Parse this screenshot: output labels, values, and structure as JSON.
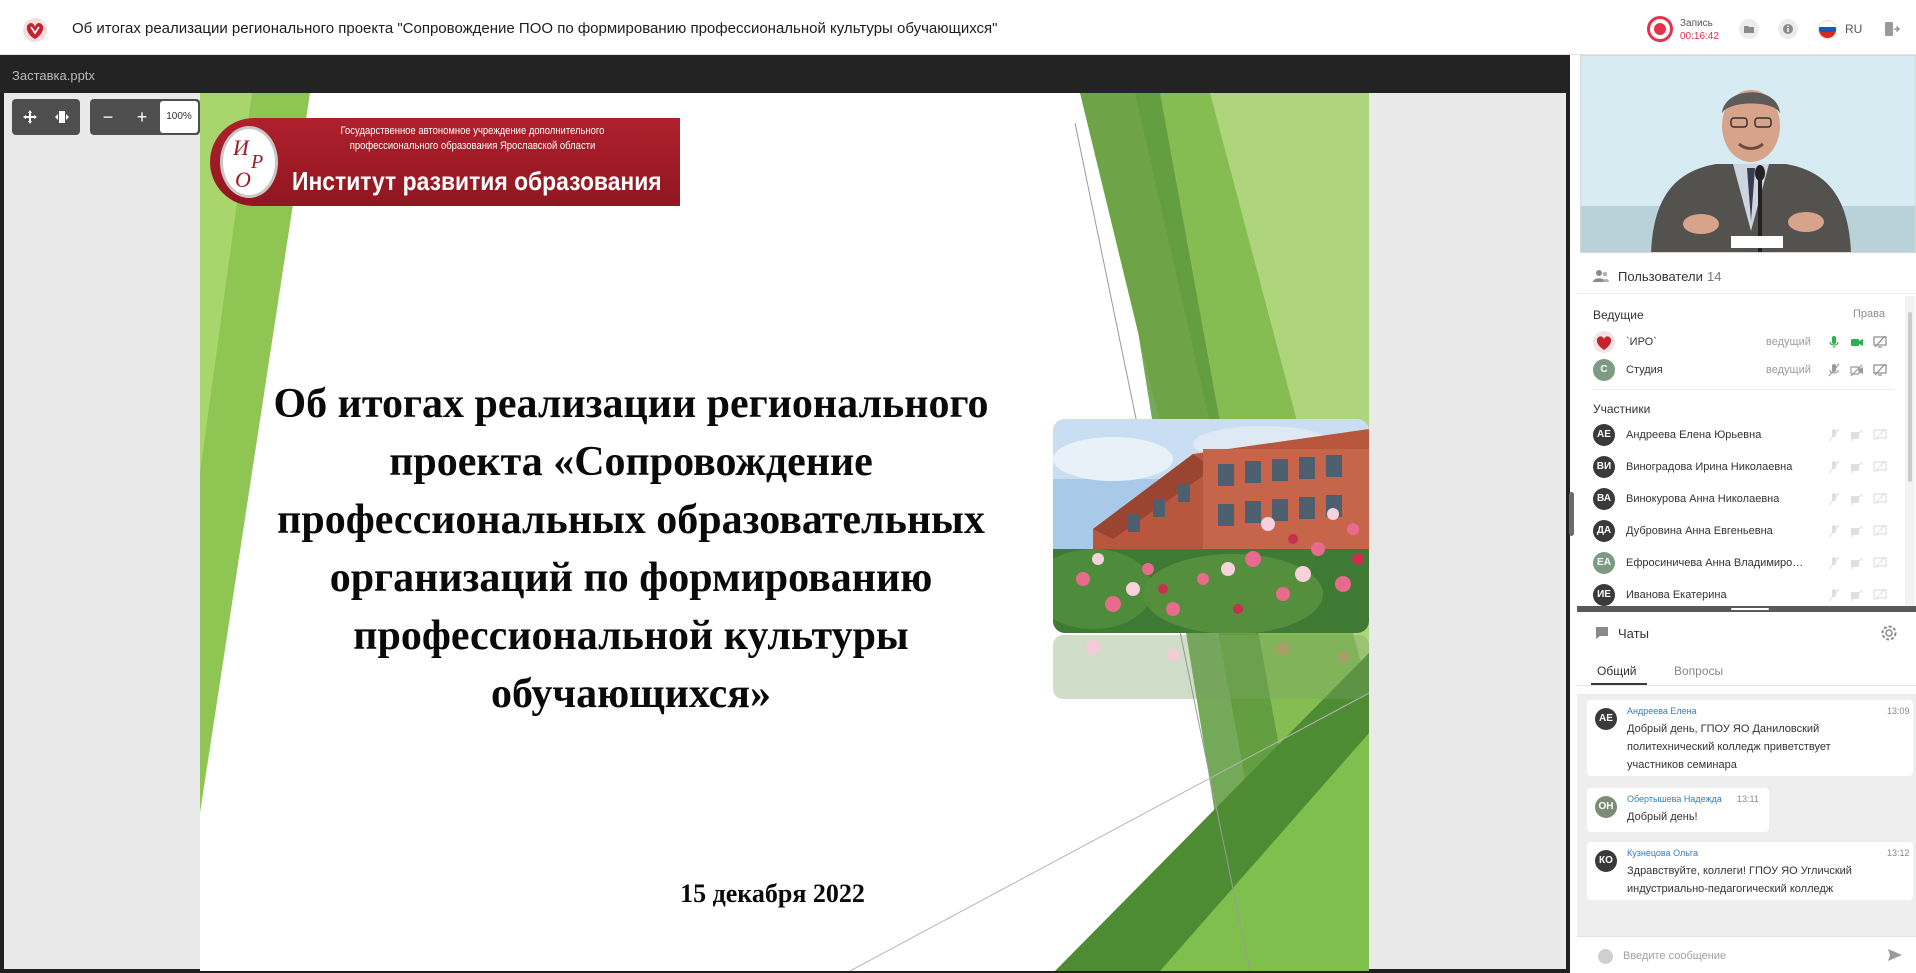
{
  "app": {
    "title": "Об итогах реализации регионального проекта \"Сопровождение ПОО по формированию профессиональной культуры обучающихся\"",
    "record_label": "Запись",
    "record_time": "00:16:42",
    "language": "RU"
  },
  "presentation": {
    "file_name": "Заставка.pptx",
    "zoom": "100%",
    "zoom_out_label": "−",
    "zoom_in_label": "+",
    "slide": {
      "org_subtitle": "Государственное автономное учреждение дополнительного профессионального образования Ярославской области",
      "org_name": "Институт развития образования",
      "emblem_text": "ИРО",
      "title": "Об итогах реализации регионального проекта «Сопровождение профессиональных образовательных организаций по формированию профессиональной культуры обучающихся»",
      "date": "15 декабря 2022"
    }
  },
  "users": {
    "header_label": "Пользователи",
    "count": "14",
    "hosts_label": "Ведущие",
    "rights_label": "Права",
    "participants_label": "Участники",
    "hosts": [
      {
        "name": "`ИРО`",
        "initials": "",
        "role": "ведущий"
      },
      {
        "name": "Студия",
        "initials": "С",
        "role": "ведущий"
      }
    ],
    "participants": [
      {
        "name": "Андреева Елена Юрьевна",
        "initials": "АЕ"
      },
      {
        "name": "Виноградова Ирина Николаевна",
        "initials": "ВИ"
      },
      {
        "name": "Винокурова Анна Николаевна",
        "initials": "ВА"
      },
      {
        "name": "Дубровина Анна Евгеньевна",
        "initials": "ДА"
      },
      {
        "name": "Ефросиничева Анна Владимиро…",
        "initials": "ЕА"
      },
      {
        "name": "Иванова Екатерина",
        "initials": "ИЕ"
      }
    ]
  },
  "chat": {
    "header_label": "Чаты",
    "tabs": [
      "Общий",
      "Вопросы"
    ],
    "messages": [
      {
        "initials": "АЕ",
        "author": "Андреева Елена",
        "time": "13:09",
        "text": "Добрый день, ГПОУ ЯО Даниловский политехнический колледж приветствует участников семинара"
      },
      {
        "initials": "ОН",
        "author": "Обертышева Надежда",
        "time": "13:11",
        "text": "Добрый день!"
      },
      {
        "initials": "КО",
        "author": "Кузнецова Ольга",
        "time": "13:12",
        "text": "Здравствуйте, коллеги! ГПОУ ЯО Угличский индустриально-педагогический колледж"
      }
    ],
    "input_placeholder": "Введите сообщение"
  },
  "colors": {
    "accent_record": "#e8304a",
    "slide_green": "#7ab648",
    "banner_red": "#a51c27",
    "author_blue": "#2f7fc4"
  }
}
